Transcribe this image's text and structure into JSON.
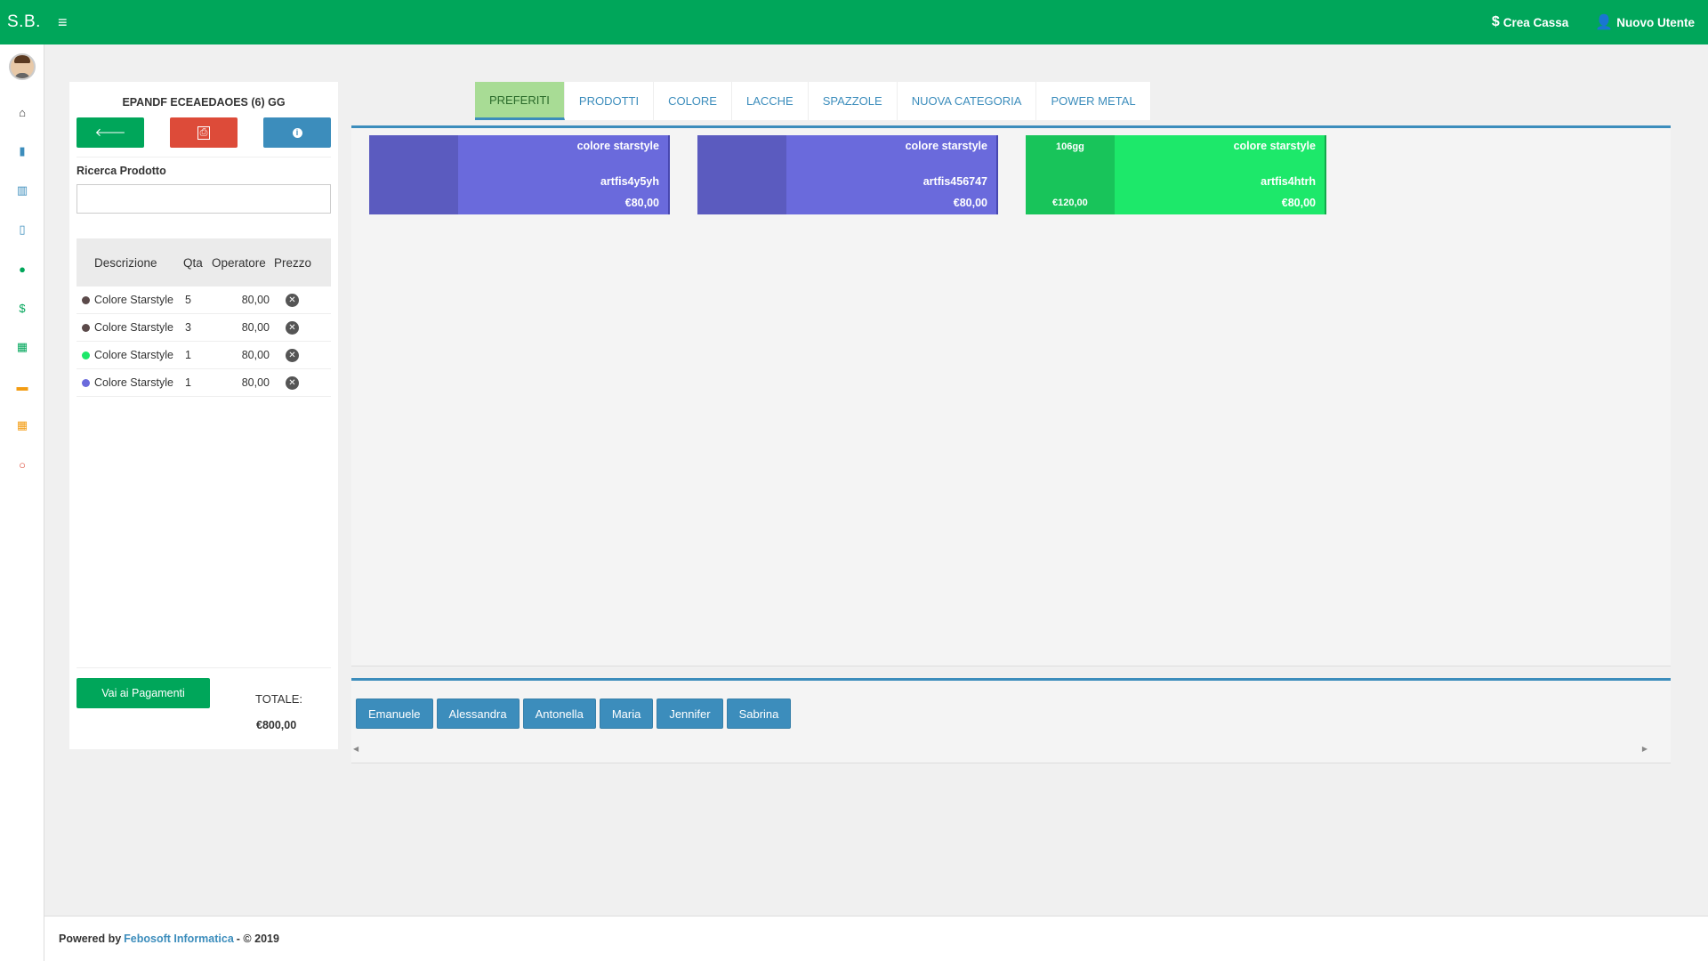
{
  "topbar": {
    "brand": "S.B.",
    "crea_cassa": "Crea Cassa",
    "nuovo_utente": "Nuovo Utente"
  },
  "sidebar": {
    "icons": [
      {
        "name": "home-icon",
        "glyph": "⌂",
        "color": "#333333"
      },
      {
        "name": "book-icon",
        "glyph": "▮",
        "color": "#3c8dbc"
      },
      {
        "name": "barcode-icon",
        "glyph": "▥",
        "color": "#3c8dbc"
      },
      {
        "name": "receipt-icon",
        "glyph": "▯",
        "color": "#3c8dbc"
      },
      {
        "name": "user-icon",
        "glyph": "●",
        "color": "#00a65a"
      },
      {
        "name": "dollar-icon",
        "glyph": "$",
        "color": "#00a65a"
      },
      {
        "name": "calendar-icon",
        "glyph": "▦",
        "color": "#00a65a"
      },
      {
        "name": "truck-icon",
        "glyph": "▬",
        "color": "#f39c12"
      },
      {
        "name": "calculator-icon",
        "glyph": "▦",
        "color": "#f39c12"
      },
      {
        "name": "power-icon",
        "glyph": "○",
        "color": "#dd4b39"
      }
    ]
  },
  "cart": {
    "title": "EPANDF ECEAEDAOES (6) GG",
    "search_label": "Ricerca Prodotto",
    "search_value": "",
    "columns": {
      "descrizione": "Descrizione",
      "qta": "Qta",
      "operatore": "Operatore",
      "prezzo": "Prezzo"
    },
    "rows": [
      {
        "descrizione": "Colore Starstyle",
        "qta": "5",
        "prezzo": "80,00",
        "dot_color": "#5b4a4a"
      },
      {
        "descrizione": "Colore Starstyle",
        "qta": "3",
        "prezzo": "80,00",
        "dot_color": "#5b4a4a"
      },
      {
        "descrizione": "Colore Starstyle",
        "qta": "1",
        "prezzo": "80,00",
        "dot_color": "#1de86a"
      },
      {
        "descrizione": "Colore Starstyle",
        "qta": "1",
        "prezzo": "80,00",
        "dot_color": "#6a6adc"
      }
    ],
    "pay_button": "Vai ai Pagamenti",
    "totale_label": "TOTALE:",
    "totale_value": "€800,00"
  },
  "tabs": [
    {
      "label": "PREFERITI",
      "active": true
    },
    {
      "label": "PRODOTTI",
      "active": false
    },
    {
      "label": "COLORE",
      "active": false
    },
    {
      "label": "LACCHE",
      "active": false
    },
    {
      "label": "SPAZZOLE",
      "active": false
    },
    {
      "label": "NUOVA CATEGORIA",
      "active": false
    },
    {
      "label": "POWER METAL",
      "active": false
    }
  ],
  "products": [
    {
      "name": "colore starstyle",
      "code": "artfis4y5yh",
      "price": "€80,00",
      "left_top": "",
      "left_bottom": "",
      "left_color": "#5b5bbf",
      "right_color": "#6a6adc",
      "edge_color": "#4747b0"
    },
    {
      "name": "colore starstyle",
      "code": "artfis456747",
      "price": "€80,00",
      "left_top": "",
      "left_bottom": "",
      "left_color": "#5b5bbf",
      "right_color": "#6a6adc",
      "edge_color": "#4747b0"
    },
    {
      "name": "colore starstyle",
      "code": "artfis4htrh",
      "price": "€80,00",
      "left_top": "106gg",
      "left_bottom": "€120,00",
      "left_color": "#18c45a",
      "right_color": "#1de86a",
      "edge_color": "#13a84b"
    }
  ],
  "operators": [
    "Emanuele",
    "Alessandra",
    "Antonella",
    "Maria",
    "Jennifer",
    "Sabrina"
  ],
  "footer": {
    "powered_by": "Powered by",
    "company": "Febosoft Informatica",
    "copyright": "- © 2019"
  }
}
